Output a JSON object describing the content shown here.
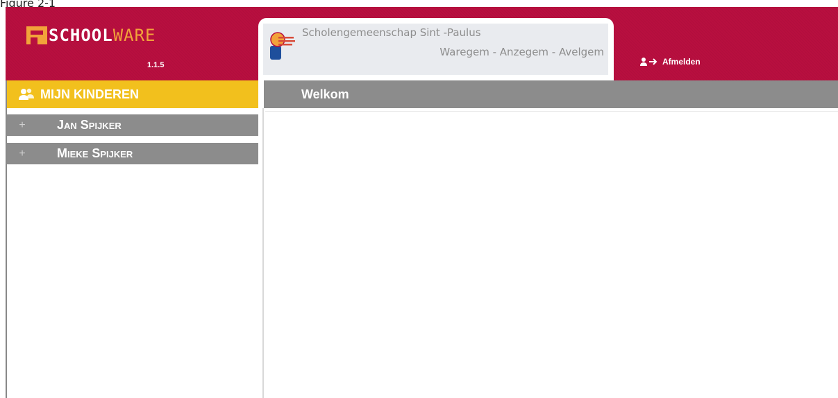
{
  "page_label": "Figure 2-1",
  "header": {
    "logo_part1": "SCHOOL",
    "logo_part2": "WARE",
    "version": "1.1.5",
    "school_name": "Scholengemeenschap Sint -Paulus",
    "school_location": "Waregem - Anzegem - Avelgem",
    "logout_label": "Afmelden"
  },
  "sidebar": {
    "title": "MIJN KINDEREN",
    "children": [
      {
        "plus": "+",
        "name": "Jan Spijker"
      },
      {
        "plus": "+",
        "name": "Mieke Spijker"
      }
    ]
  },
  "main": {
    "title": "Welkom"
  },
  "colors": {
    "header_bg": "#b80f3f",
    "logo_accent": "#f2a33a",
    "sidebar_header": "#f2c01d",
    "gray_bar": "#8c8c8c"
  },
  "icons": {
    "logo": "schoolware-logo-icon",
    "school": "school-crest-icon",
    "logout": "logout-user-arrow-icon",
    "children": "users-group-icon",
    "expand": "plus-icon"
  }
}
